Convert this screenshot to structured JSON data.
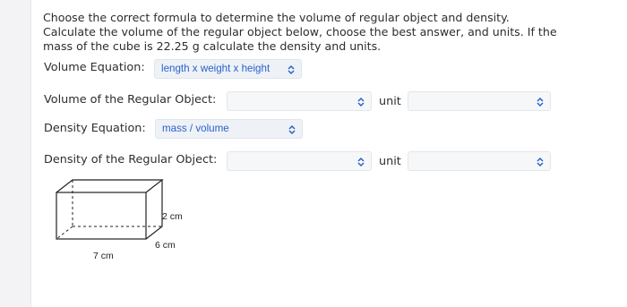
{
  "question": {
    "line1": "Choose the correct formula to determine the volume of regular object and density.",
    "line2": "Calculate the volume of the regular object below, choose the best answer, and units. If the",
    "line3": "mass of the cube is 22.25 g calculate the density and units."
  },
  "volume_equation": {
    "label": "Volume Equation:",
    "selected": "length x weight x height"
  },
  "volume_regular": {
    "label": "Volume of the Regular Object:",
    "unit_label": "unit"
  },
  "density_equation": {
    "label": "Density Equation:",
    "selected": "mass / volume"
  },
  "density_regular": {
    "label": "Density of the Regular Object:",
    "unit_label": "unit"
  },
  "diagram": {
    "height_label": "2 cm",
    "depth_label": "6 cm",
    "width_label": "7 cm"
  },
  "colors": {
    "accent": "#2a62c9",
    "select_bg": "#eef2f7"
  }
}
